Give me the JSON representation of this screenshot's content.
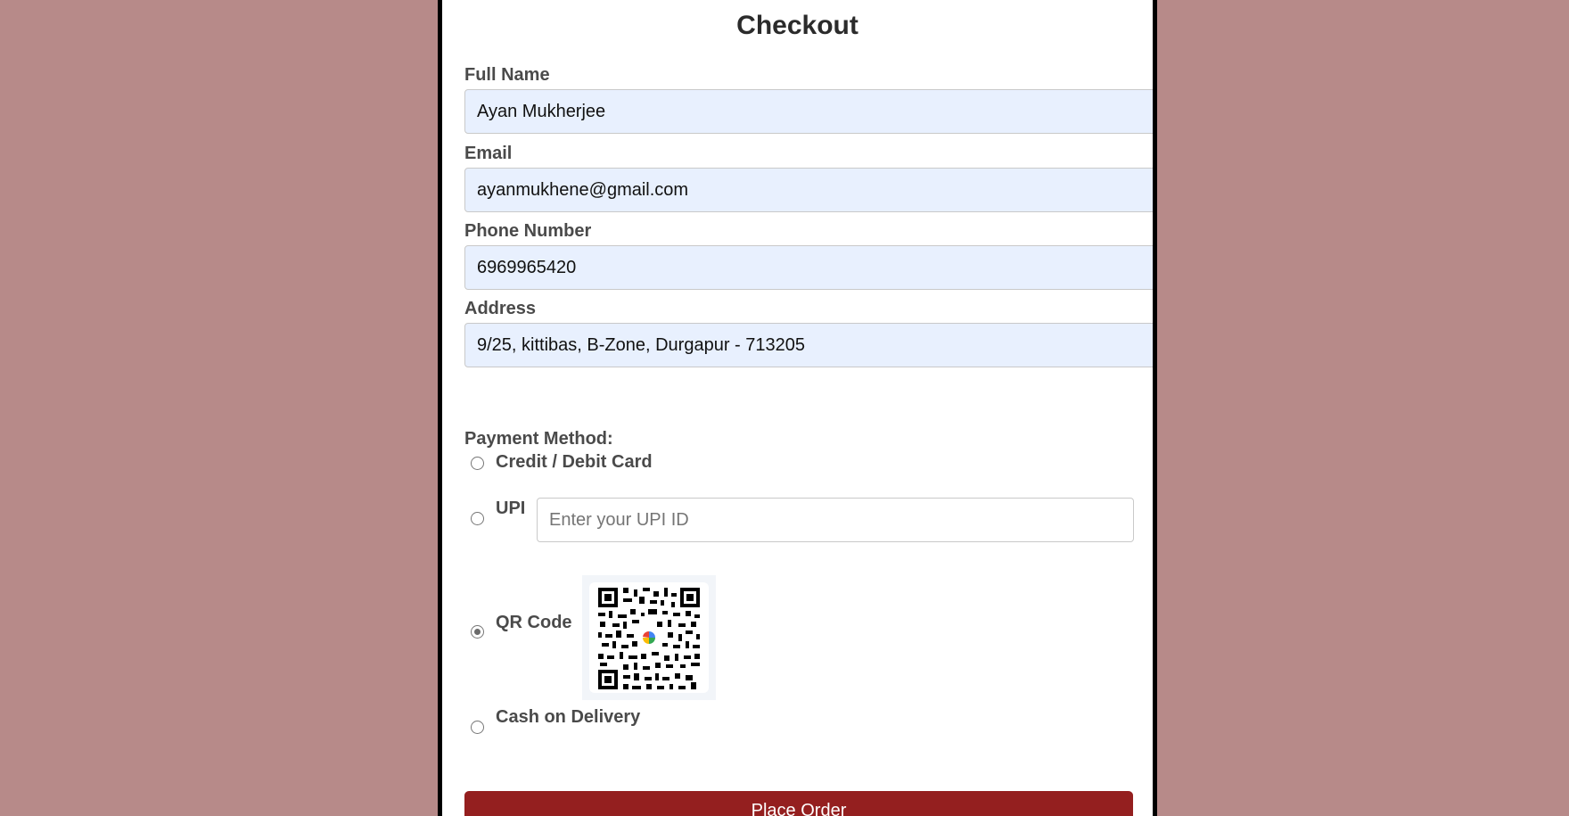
{
  "checkout": {
    "title": "Checkout",
    "fields": {
      "full_name": {
        "label": "Full Name",
        "value": "Ayan Mukherjee"
      },
      "email": {
        "label": "Email",
        "value": "ayanmukhene@gmail.com"
      },
      "phone": {
        "label": "Phone Number",
        "value": "6969965420"
      },
      "address": {
        "label": "Address",
        "value": "9/25, kittibas, B-Zone, Durgapur - 713205"
      }
    },
    "payment": {
      "title": "Payment Method:",
      "options": {
        "card": {
          "label": "Credit / Debit Card",
          "selected": false
        },
        "upi": {
          "label": "UPI",
          "selected": false,
          "placeholder": "Enter your UPI ID"
        },
        "qr": {
          "label": "QR Code",
          "selected": true
        },
        "cod": {
          "label": "Cash on Delivery",
          "selected": false
        }
      }
    },
    "submit_label": "Place Order"
  },
  "colors": {
    "background": "#b78a89",
    "card": "#ffffff",
    "input_fill": "#e8f0fe",
    "button": "#941f1f",
    "label_text": "#4a4a4a"
  },
  "icons": {
    "qr": "qr-code-image",
    "radio": "radio-button"
  }
}
